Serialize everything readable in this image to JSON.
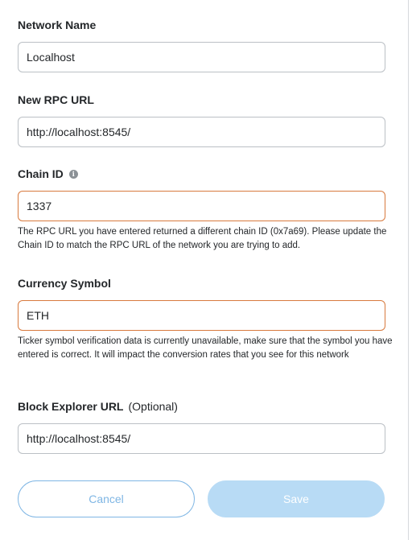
{
  "network_name": {
    "label": "Network Name",
    "value": "Localhost"
  },
  "rpc_url": {
    "label": "New RPC URL",
    "value": "http://localhost:8545/"
  },
  "chain_id": {
    "label": "Chain ID",
    "info_icon": "info-icon",
    "value": "1337",
    "warning": "The RPC URL you have entered returned a different chain ID (0x7a69). Please update the Chain ID to match the RPC URL of the network you are trying to add."
  },
  "currency_symbol": {
    "label": "Currency Symbol",
    "value": "ETH",
    "warning": "Ticker symbol verification data is currently unavailable, make sure that the symbol you have entered is correct. It will impact the conversion rates that you see for this network"
  },
  "block_explorer": {
    "label": "Block Explorer URL",
    "optional": "(Optional)",
    "value": "http://localhost:8545/"
  },
  "buttons": {
    "cancel": "Cancel",
    "save": "Save"
  },
  "colors": {
    "warning_border": "#d87a3e",
    "primary": "#7fb6e4",
    "save_disabled": "#b8dbf5"
  }
}
